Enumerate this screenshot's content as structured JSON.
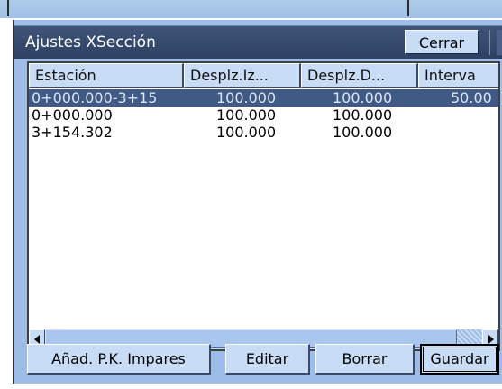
{
  "dialog": {
    "title": "Ajustes XSección",
    "close_label": "Cerrar"
  },
  "table": {
    "columns": [
      "Estación",
      "Desplz.Iz...",
      "Desplz.D...",
      "Interva"
    ],
    "rows": [
      {
        "station": "0+000.000-3+15",
        "left": "100.000",
        "right": "100.000",
        "interval": "50.00",
        "selected": true
      },
      {
        "station": "0+000.000",
        "left": "100.000",
        "right": "100.000",
        "interval": "",
        "selected": false
      },
      {
        "station": "3+154.302",
        "left": "100.000",
        "right": "100.000",
        "interval": "",
        "selected": false
      }
    ]
  },
  "buttons": {
    "add_odd_stations": "Añad. P.K. Impares",
    "edit": "Editar",
    "delete": "Borrar",
    "save": "Guardar"
  },
  "colors": {
    "titlebar": "#2e4164",
    "dialog_bg": "#9dbde8",
    "button_bg": "#c9dcf5",
    "selection": "#3f5b85"
  },
  "icons": {
    "scroll_left": "scroll-left-arrow-icon",
    "scroll_right": "scroll-right-arrow-icon"
  }
}
